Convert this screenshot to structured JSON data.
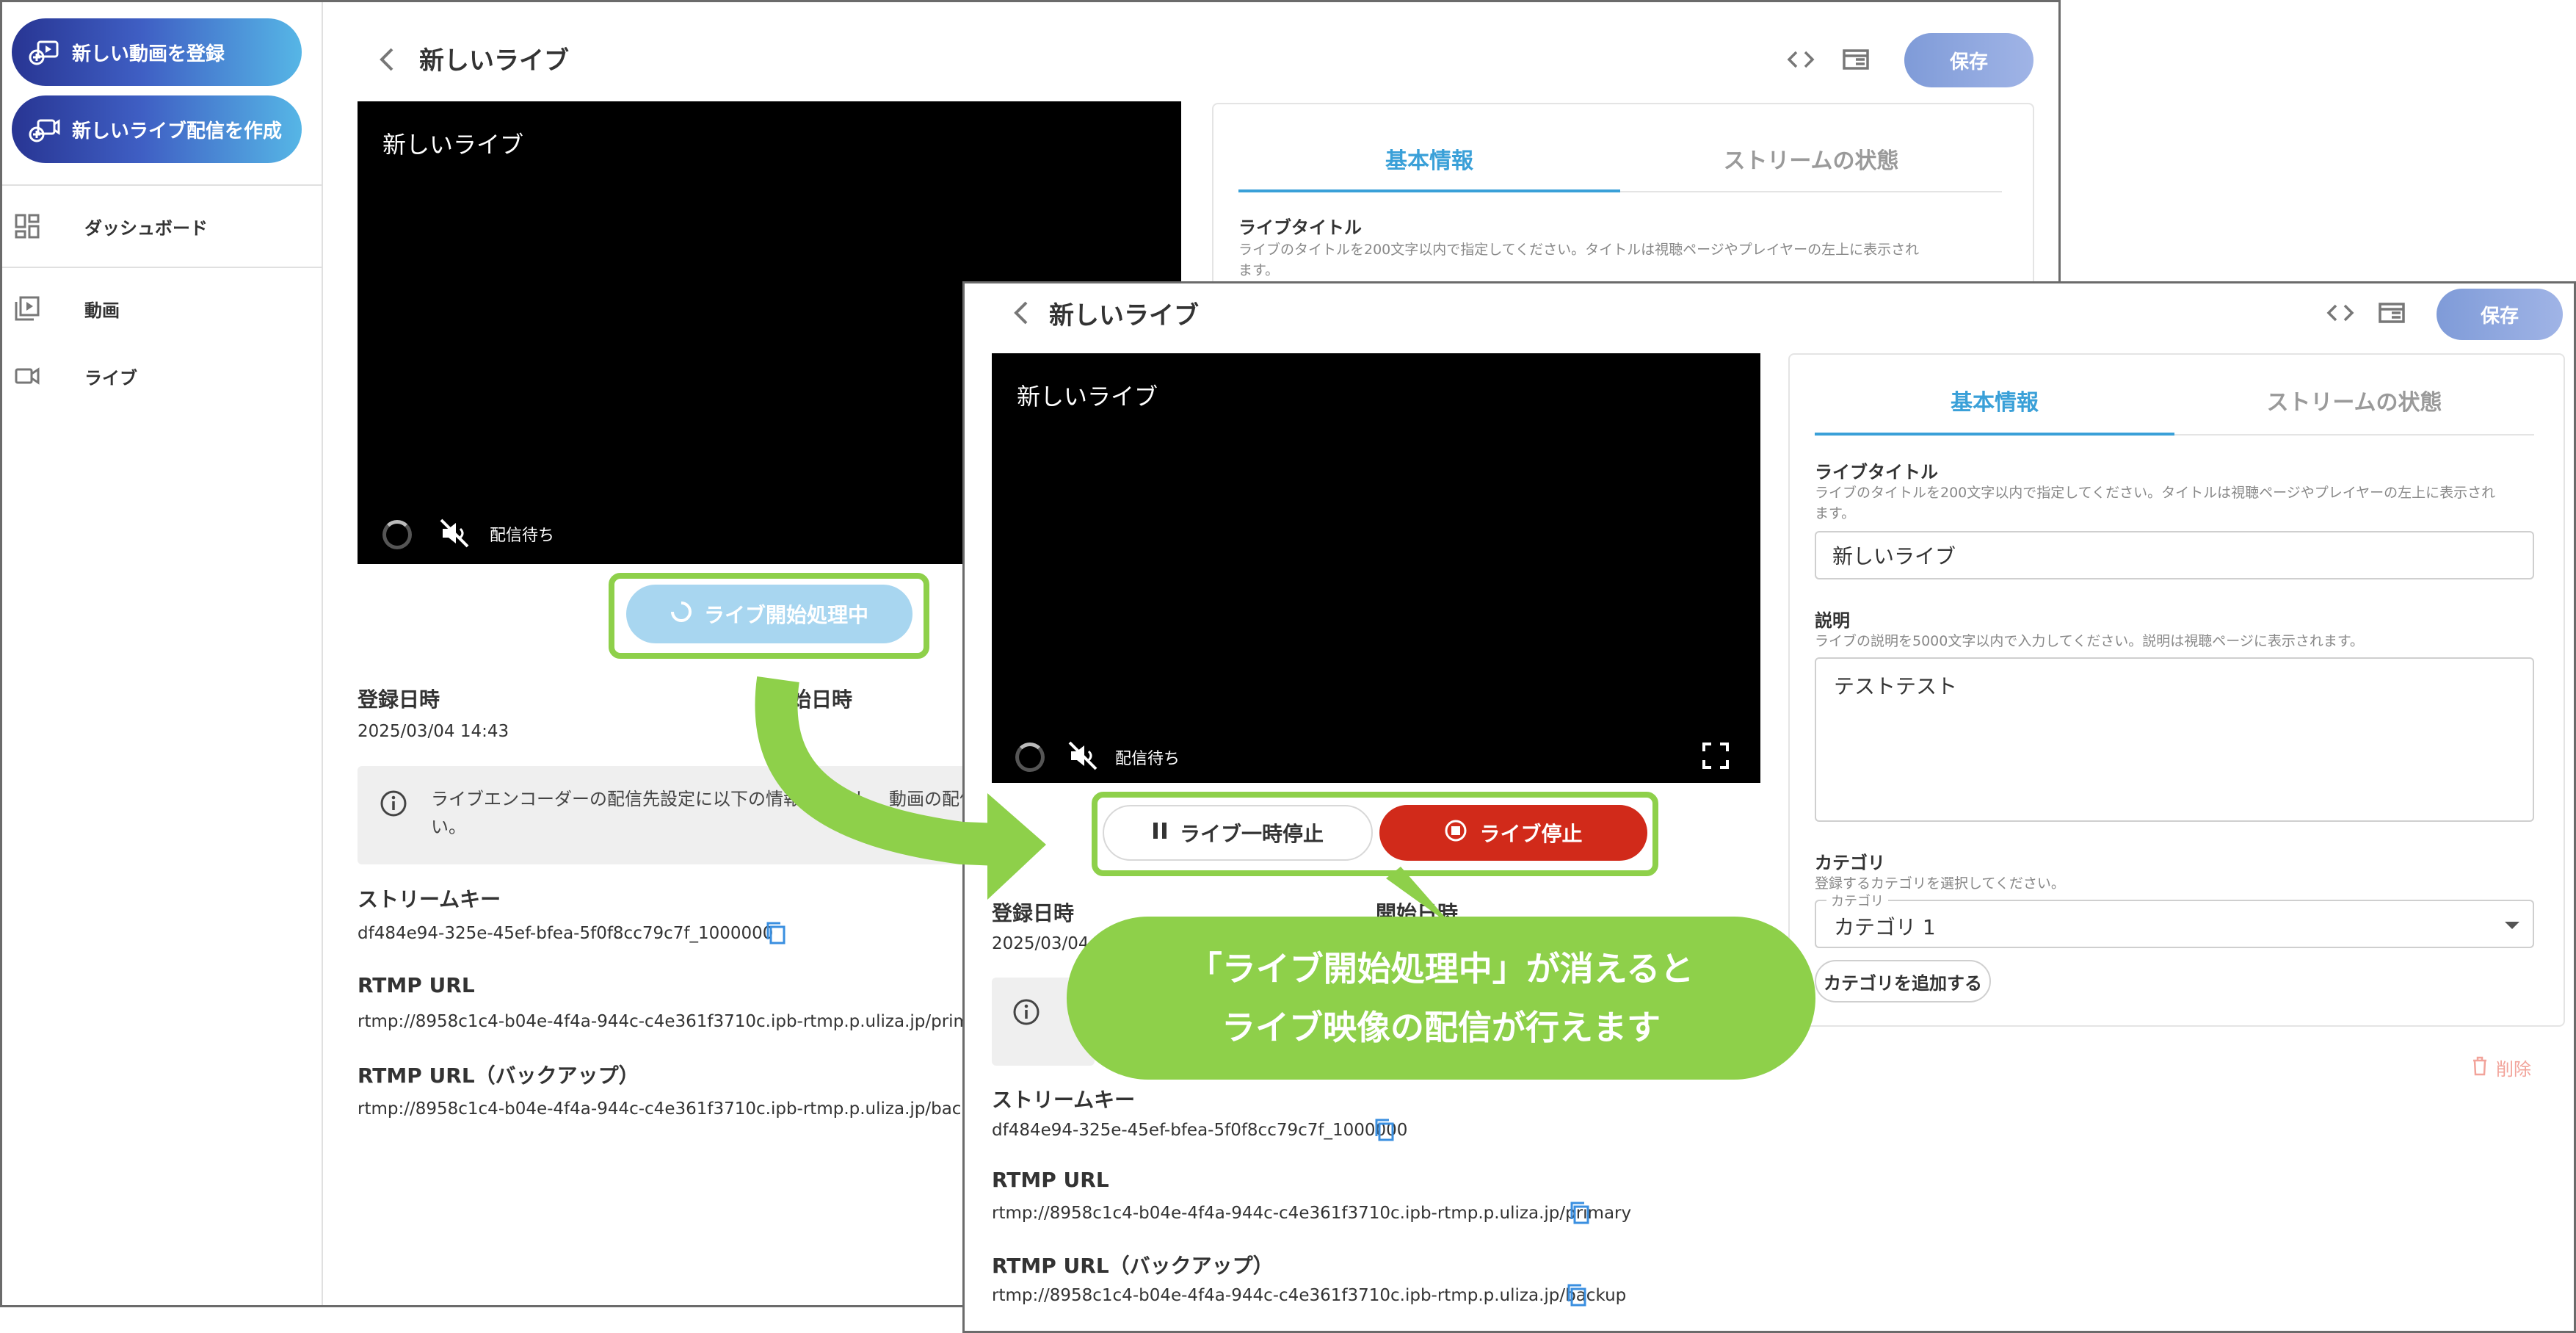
{
  "sidebar": {
    "create_video": "新しい動画を登録",
    "create_live": "新しいライブ配信を作成",
    "items": [
      {
        "label": "ダッシュボード",
        "icon": "dashboard-icon"
      },
      {
        "label": "動画",
        "icon": "video-library-icon"
      },
      {
        "label": "ライブ",
        "icon": "videocam-icon"
      }
    ]
  },
  "page": {
    "title": "新しいライブ",
    "save_label": "保存"
  },
  "player": {
    "title": "新しいライブ",
    "status": "配信待ち"
  },
  "back_window": {
    "starting_button": "ライブ開始処理中",
    "info_text_line1": "ライブエンコーダーの配信先設定に以下の情報を入力し、動画の配信を開始してくださ",
    "info_text_line2": "い。"
  },
  "controls": {
    "pause_label": "ライブ一時停止",
    "stop_label": "ライブ停止"
  },
  "tabs": {
    "basic": "基本情報",
    "stream": "ストリームの状態"
  },
  "form": {
    "title_label": "ライブタイトル",
    "title_help_line1": "ライブのタイトルを200文字以内で指定してください。タイトルは視聴ページやプレイヤーの左上に表示され",
    "title_help_line2": "ます。",
    "title_value": "新しいライブ",
    "desc_label": "説明",
    "desc_help": "ライブの説明を5000文字以内で入力してください。説明は視聴ページに表示されます。",
    "desc_value": "テストテスト",
    "category_label": "カテゴリ",
    "category_help": "登録するカテゴリを選択してください。",
    "category_legend": "カテゴリ",
    "category_value": "カテゴリ 1",
    "add_category": "カテゴリを追加する",
    "delete": "削除"
  },
  "meta": {
    "registered_label": "登録日時",
    "registered_value": "2025/03/04 14:43",
    "registered_value_short": "2025/03/04 14",
    "start_label": "開始日時",
    "start_label_partial": "日時",
    "start_value": "-",
    "stream_key_label": "ストリームキー",
    "stream_key": "df484e94-325e-45ef-bfea-5f0f8cc79c7f_1000000",
    "rtmp_label": "RTMP URL",
    "rtmp_url": "rtmp://8958c1c4-b04e-4f4a-944c-c4e361f3710c.ipb-rtmp.p.uliza.jp/primary",
    "rtmp_backup_label": "RTMP URL（バックアップ）",
    "rtmp_backup_url": "rtmp://8958c1c4-b04e-4f4a-944c-c4e361f3710c.ipb-rtmp.p.uliza.jp/backup"
  },
  "callout": {
    "line1": "「ライブ開始処理中」が消えると",
    "line2": "ライブ映像の配信が行えます"
  },
  "colors": {
    "accent_green": "#8ed04a",
    "stop_red": "#d12a1a",
    "tab_blue": "#3aa0d8",
    "starting_blue": "#a8d6f0"
  }
}
